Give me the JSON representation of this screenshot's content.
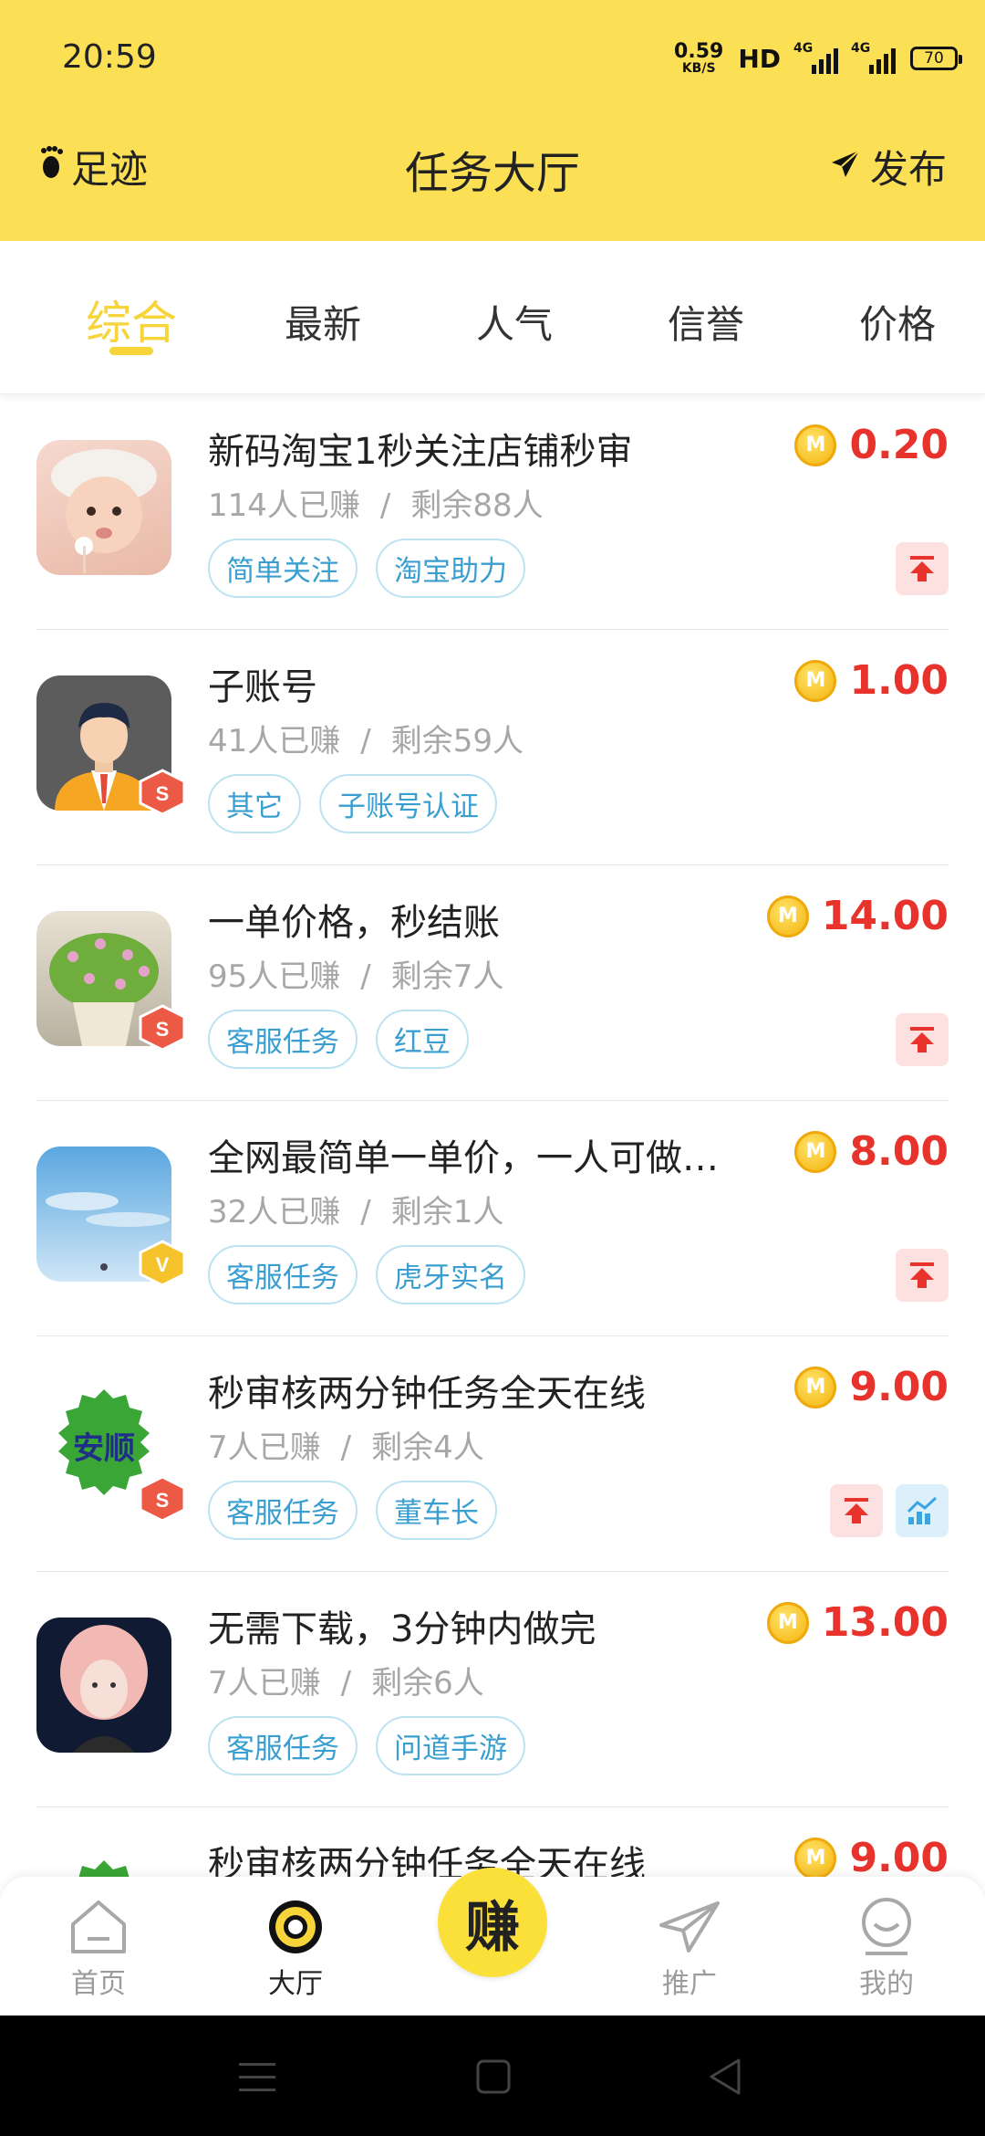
{
  "status": {
    "time": "20:59",
    "net_speed_value": "0.59",
    "net_speed_unit": "KB/S",
    "hd": "HD",
    "signal_labels": [
      "4G",
      "4G"
    ],
    "battery": "70"
  },
  "navbar": {
    "left_label": "足迹",
    "title": "任务大厅",
    "right_label": "发布"
  },
  "tabs": [
    "综合",
    "最新",
    "人气",
    "信誉",
    "价格"
  ],
  "tasks": [
    {
      "title": "新码淘宝1秒关注店铺秒审",
      "earned": "114人已赚",
      "remaining": "剩余88人",
      "tags": [
        "简单关注",
        "淘宝助力"
      ],
      "price": "0.20",
      "badge": "",
      "actions": [
        "top"
      ]
    },
    {
      "title": "子账号",
      "earned": "41人已赚",
      "remaining": "剩余59人",
      "tags": [
        "其它",
        "子账号认证"
      ],
      "price": "1.00",
      "badge": "S",
      "actions": []
    },
    {
      "title": "一单价格，秒结账",
      "earned": "95人已赚",
      "remaining": "剩余7人",
      "tags": [
        "客服任务",
        "红豆"
      ],
      "price": "14.00",
      "badge": "S",
      "actions": [
        "top"
      ]
    },
    {
      "title": "全网最简单一单价，一人可做…",
      "earned": "32人已赚",
      "remaining": "剩余1人",
      "tags": [
        "客服任务",
        "虎牙实名"
      ],
      "price": "8.00",
      "badge": "V",
      "actions": [
        "top"
      ]
    },
    {
      "title": "秒审核两分钟任务全天在线",
      "earned": "7人已赚",
      "remaining": "剩余4人",
      "tags": [
        "客服任务",
        "董车长"
      ],
      "price": "9.00",
      "badge": "S",
      "actions": [
        "top",
        "promo"
      ],
      "avatar_text": "安顺"
    },
    {
      "title": "无需下载，3分钟内做完",
      "earned": "7人已赚",
      "remaining": "剩余6人",
      "tags": [
        "客服任务",
        "问道手游"
      ],
      "price": "13.00",
      "badge": "",
      "actions": []
    },
    {
      "title": "秒审核两分钟任务全天在线",
      "earned": "",
      "remaining": "",
      "tags": [],
      "price": "9.00",
      "badge": "",
      "actions": []
    }
  ],
  "separator": "/",
  "coin_letter": "M",
  "bottom_nav": {
    "items": [
      "首页",
      "大厅",
      "推广",
      "我的"
    ],
    "earn": "赚"
  },
  "colors": {
    "brand_yellow": "#FBE056",
    "price_red": "#e8322c",
    "tag_blue": "#3a9fd0"
  }
}
